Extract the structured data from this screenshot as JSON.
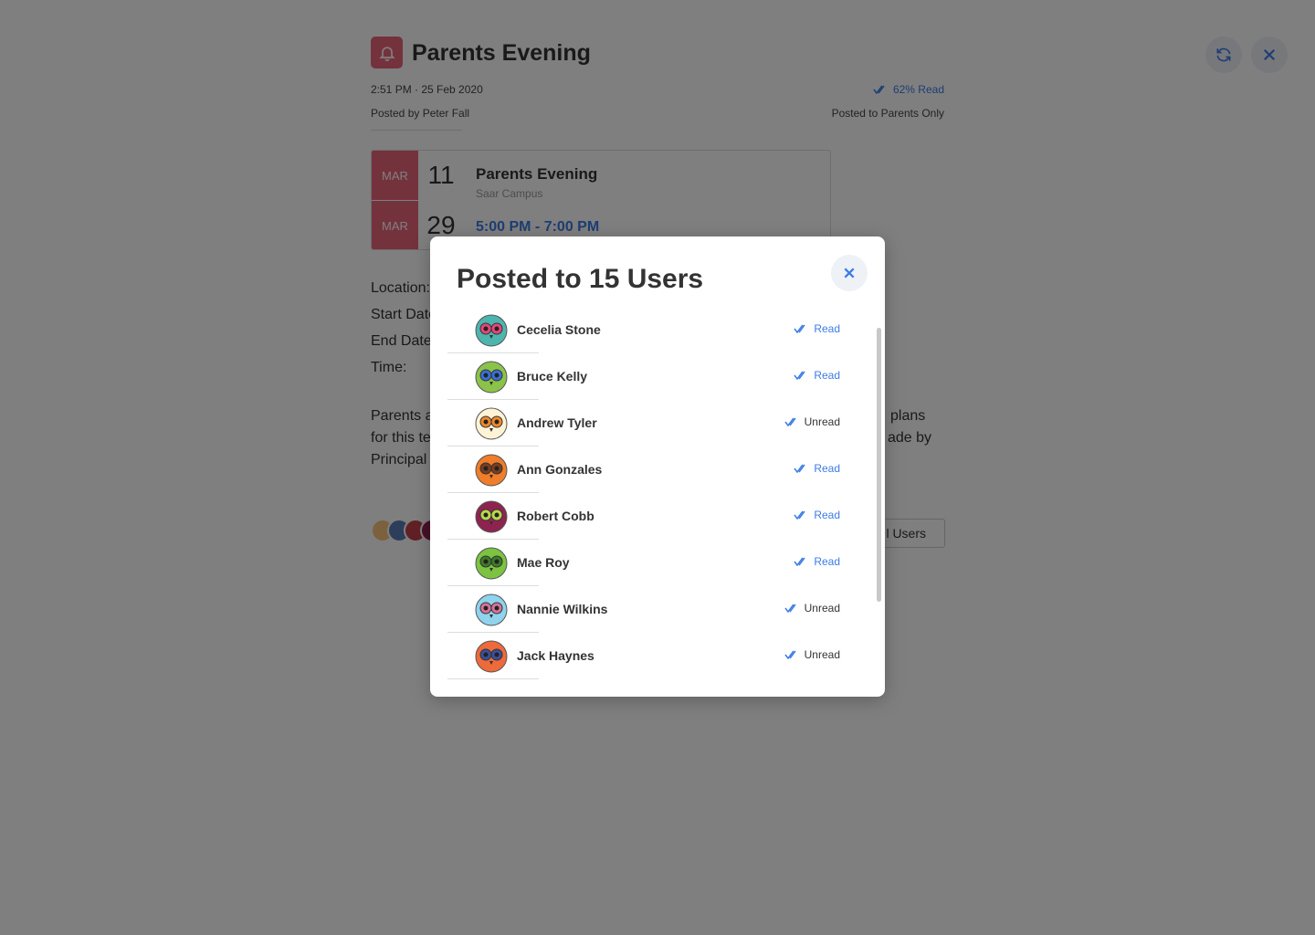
{
  "header": {
    "title": "Parents Evening",
    "timestamp": "2:51 PM · 25 Feb 2020",
    "posted_by": "Posted by Peter Fall",
    "read_percent": "62% Read",
    "posted_to": "Posted to Parents Only"
  },
  "event": {
    "start_month": "MAR",
    "start_day": "11",
    "end_month": "MAR",
    "end_day": "29",
    "title": "Parents Evening",
    "campus": "Saar Campus",
    "time": "5:00 PM - 7:00 PM"
  },
  "details": {
    "location_label": "Location:",
    "start_label": "Start Date",
    "end_label": "End Date",
    "time_label": "Time:"
  },
  "description": {
    "line1_left": "Parents a",
    "line1_right": "plans",
    "line2_left": "for this te",
    "line2_right": "ade by",
    "line3_left": "Principal"
  },
  "all_users_button": "l Users",
  "modal": {
    "title": "Posted to 15 Users",
    "users": [
      {
        "name": "Cecelia Stone",
        "status": "Read",
        "read": true,
        "avatar_color": "#4cb5ad",
        "accent": "#e8457a"
      },
      {
        "name": "Bruce Kelly",
        "status": "Read",
        "read": true,
        "avatar_color": "#8bc34a",
        "accent": "#3a6fd8"
      },
      {
        "name": "Andrew Tyler",
        "status": "Unread",
        "read": false,
        "avatar_color": "#fff3d6",
        "accent": "#f0892a"
      },
      {
        "name": "Ann Gonzales",
        "status": "Read",
        "read": true,
        "avatar_color": "#ef7d2a",
        "accent": "#7a3d1f"
      },
      {
        "name": "Robert Cobb",
        "status": "Read",
        "read": true,
        "avatar_color": "#8e2350",
        "accent": "#b8d84a"
      },
      {
        "name": "Mae Roy",
        "status": "Read",
        "read": true,
        "avatar_color": "#7cc342",
        "accent": "#3d7a28"
      },
      {
        "name": "Nannie Wilkins",
        "status": "Unread",
        "read": false,
        "avatar_color": "#8fd3ec",
        "accent": "#d8739a"
      },
      {
        "name": "Jack Haynes",
        "status": "Unread",
        "read": false,
        "avatar_color": "#ee6a3a",
        "accent": "#3a4f9a"
      }
    ]
  },
  "colors": {
    "brand": "#e8657a",
    "accent": "#3d7ce6"
  }
}
